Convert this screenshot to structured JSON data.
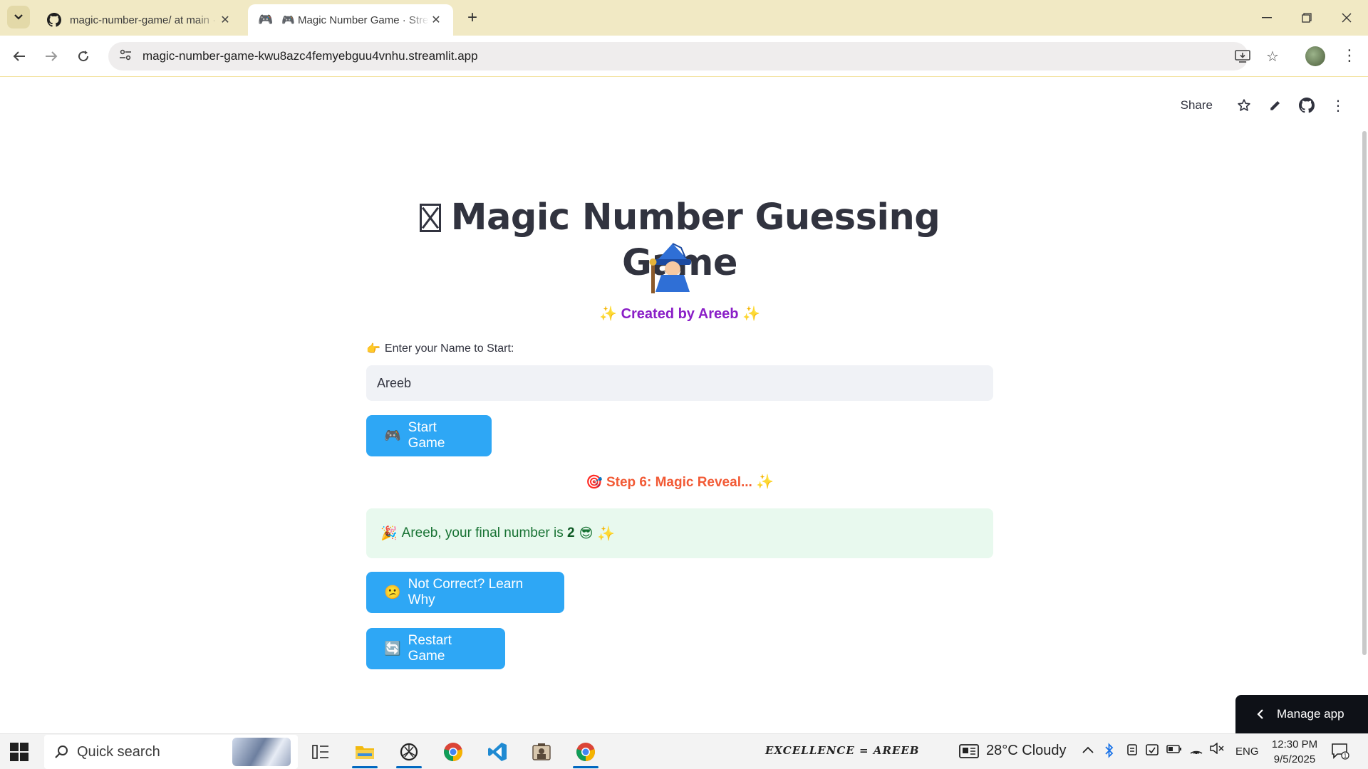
{
  "browser": {
    "tabs": [
      {
        "title": "magic-number-game/ at main · areeb",
        "active": false,
        "icon": "github-icon"
      },
      {
        "title": "🎮 Magic Number Game · Streamlit",
        "active": true,
        "icon": "gamepad-icon"
      }
    ],
    "url": "magic-number-game-kwu8azc4femyebguu4vnhu.streamlit.app"
  },
  "app_header": {
    "share_label": "Share"
  },
  "app": {
    "title": "Magic Number Guessing Game",
    "subtitle": "Created by Areeb",
    "name_label": "Enter your Name to Start:",
    "name_value": "Areeb",
    "start_button": "Start Game",
    "step_heading": "Step 6: Magic Reveal...",
    "result_prefix": "Areeb, your final number is ",
    "result_number": "2",
    "learn_button": "Not Correct? Learn Why",
    "restart_button": "Restart Game",
    "manage_app": "Manage app",
    "accent_color": "#2ea7f5"
  },
  "taskbar": {
    "search_label": "Quick search",
    "motto": "EXCELLENCE = AREEB",
    "weather": "28°C  Cloudy",
    "language": "ENG",
    "time": "12:30 PM",
    "date": "9/5/2025",
    "notification_count": "1"
  }
}
